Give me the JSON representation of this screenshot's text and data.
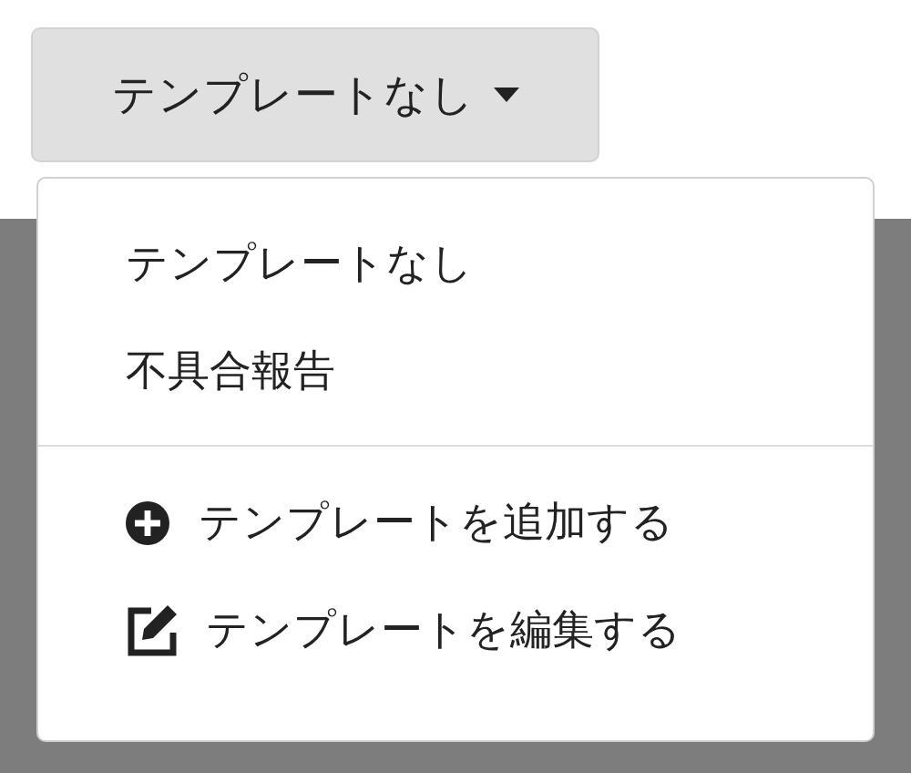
{
  "dropdown_button": {
    "label": "テンプレートなし"
  },
  "menu": {
    "options": [
      {
        "label": "テンプレートなし"
      },
      {
        "label": "不具合報告"
      }
    ],
    "actions": [
      {
        "kind": "add",
        "label": "テンプレートを追加する"
      },
      {
        "kind": "edit",
        "label": "テンプレートを編集する"
      }
    ]
  }
}
